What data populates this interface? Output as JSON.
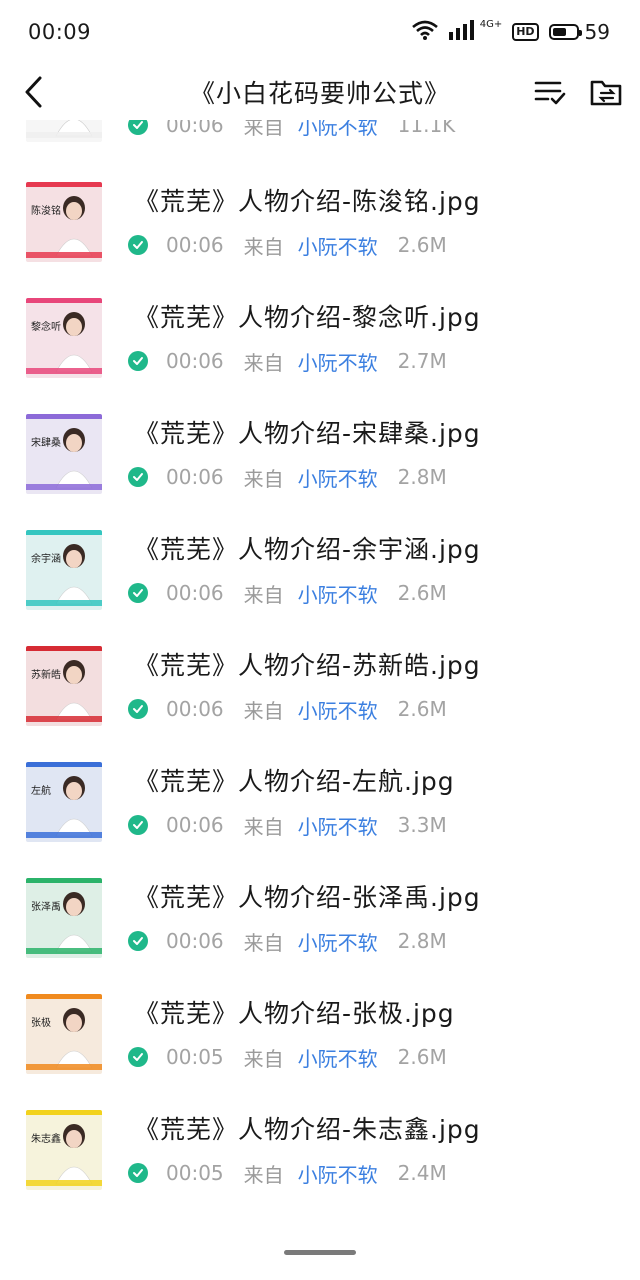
{
  "status_bar": {
    "time": "00:09",
    "network": "4G+",
    "hd": "HD",
    "battery_level": 59,
    "battery": "59"
  },
  "header": {
    "title": "《小白花码要帅公式》"
  },
  "files": [
    {
      "name": "",
      "time": "00:06",
      "from": "来自",
      "sender": "小阮不软",
      "size": "11.1K",
      "thumb_color": "#eeeeee",
      "thumb_label": ""
    },
    {
      "name": "《荒芜》人物介绍-陈浚铭.jpg",
      "time": "00:06",
      "from": "来自",
      "sender": "小阮不软",
      "size": "2.6M",
      "thumb_color": "#e63950",
      "thumb_label": "陈浚铭"
    },
    {
      "name": "《荒芜》人物介绍-黎念听.jpg",
      "time": "00:06",
      "from": "来自",
      "sender": "小阮不软",
      "size": "2.7M",
      "thumb_color": "#e8467a",
      "thumb_label": "黎念听"
    },
    {
      "name": "《荒芜》人物介绍-宋肆桑.jpg",
      "time": "00:06",
      "from": "来自",
      "sender": "小阮不软",
      "size": "2.8M",
      "thumb_color": "#8c6ad8",
      "thumb_label": "宋肆桑"
    },
    {
      "name": "《荒芜》人物介绍-余宇涵.jpg",
      "time": "00:06",
      "from": "来自",
      "sender": "小阮不软",
      "size": "2.6M",
      "thumb_color": "#34c6c0",
      "thumb_label": "余宇涵"
    },
    {
      "name": "《荒芜》人物介绍-苏新皓.jpg",
      "time": "00:06",
      "from": "来自",
      "sender": "小阮不软",
      "size": "2.6M",
      "thumb_color": "#d62b34",
      "thumb_label": "苏新皓"
    },
    {
      "name": "《荒芜》人物介绍-左航.jpg",
      "time": "00:06",
      "from": "来自",
      "sender": "小阮不软",
      "size": "3.3M",
      "thumb_color": "#3a6fd8",
      "thumb_label": "左航"
    },
    {
      "name": "《荒芜》人物介绍-张泽禹.jpg",
      "time": "00:06",
      "from": "来自",
      "sender": "小阮不软",
      "size": "2.8M",
      "thumb_color": "#2bb36a",
      "thumb_label": "张泽禹"
    },
    {
      "name": "《荒芜》人物介绍-张极.jpg",
      "time": "00:05",
      "from": "来自",
      "sender": "小阮不软",
      "size": "2.6M",
      "thumb_color": "#f08a1e",
      "thumb_label": "张极"
    },
    {
      "name": "《荒芜》人物介绍-朱志鑫.jpg",
      "time": "00:05",
      "from": "来自",
      "sender": "小阮不软",
      "size": "2.4M",
      "thumb_color": "#f2d21c",
      "thumb_label": "朱志鑫"
    }
  ],
  "icons": {
    "back": "chevron-left-icon",
    "sort": "sort-list-icon",
    "folder": "folder-transfer-icon",
    "check": "check-circle-icon",
    "wifi": "wifi-icon",
    "signal": "signal-icon"
  },
  "colors": {
    "check": "#1fb88a",
    "sender": "#3b7fe0",
    "meta": "#a3a3a3"
  }
}
